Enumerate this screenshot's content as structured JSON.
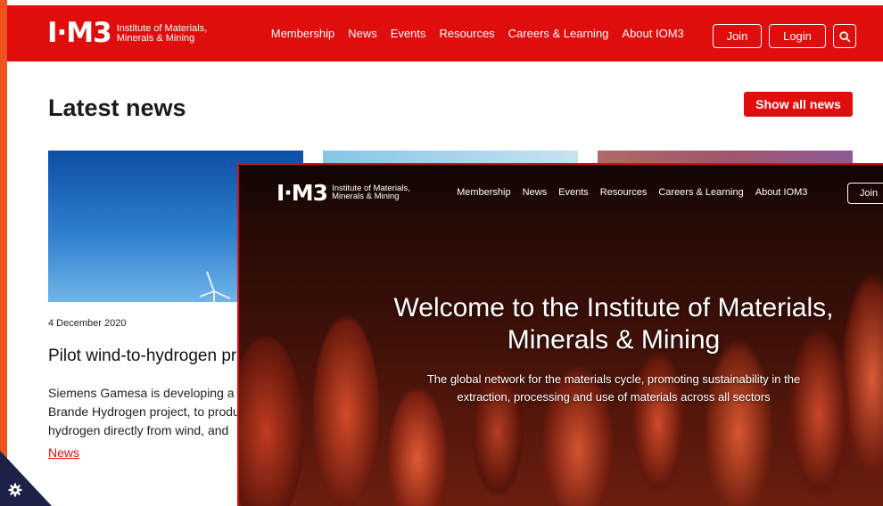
{
  "site": {
    "logo_mark": "I·M3",
    "logo_line1": "Institute of Materials,",
    "logo_line2": "Minerals & Mining"
  },
  "nav": {
    "items": [
      "Membership",
      "News",
      "Events",
      "Resources",
      "Careers & Learning",
      "About IOM3"
    ],
    "join": "Join",
    "login": "Login"
  },
  "news": {
    "heading": "Latest news",
    "show_all": "Show all news",
    "card": {
      "date": "4 December 2020",
      "title": "Pilot wind-to-hydrogen pr",
      "body_lines": [
        "Siemens Gamesa is developing a p",
        "Brande Hydrogen project, to produ",
        "hydrogen directly from wind, and"
      ],
      "tag": "News"
    }
  },
  "hero": {
    "title_line1": "Welcome to the Institute of Materials,",
    "title_line2": "Minerals & Mining",
    "subtitle_line1": "The global network for the materials cycle, promoting sustainability in the",
    "subtitle_line2": "extraction, processing and use of materials across all sectors"
  },
  "colors": {
    "brand_red": "#e00d0d",
    "frame_orange": "#f0541e",
    "cookie_navy": "#1d2148"
  },
  "icons": {
    "search": "search-icon",
    "cookie": "gear-icon"
  }
}
